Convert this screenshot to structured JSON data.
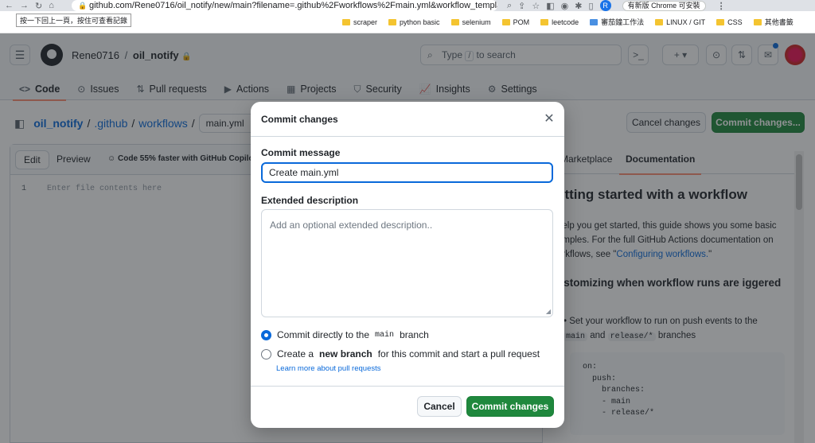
{
  "browser": {
    "url": "github.com/Rene0716/oil_notify/new/main?filename=.github%2Fworkflows%2Fmain.yml&workflow_template=blank",
    "tooltip": "按一下回上一頁，按住可查看記錄",
    "profile_letter": "R",
    "update_label": "有新版 Chrome 可安裝",
    "bookmarks": [
      "scraper",
      "python basic",
      "selenium",
      "POM",
      "leetcode",
      "審茄鐘工作法",
      "LINUX / GIT",
      "CSS"
    ],
    "other_bookmarks": "其他書籤"
  },
  "header": {
    "owner": "Rene0716",
    "separator": "/",
    "repo": "oil_notify",
    "search_placeholder_before": "Type",
    "search_key": "/",
    "search_placeholder_after": "to search",
    "command_label": ">_",
    "plus_label": "+ ▾"
  },
  "tabs": [
    {
      "label": "Code",
      "icon": "code-icon"
    },
    {
      "label": "Issues",
      "icon": "issue-icon"
    },
    {
      "label": "Pull requests",
      "icon": "pull-request-icon"
    },
    {
      "label": "Actions",
      "icon": "play-icon"
    },
    {
      "label": "Projects",
      "icon": "table-icon"
    },
    {
      "label": "Security",
      "icon": "shield-icon"
    },
    {
      "label": "Insights",
      "icon": "graph-icon"
    },
    {
      "label": "Settings",
      "icon": "gear-icon"
    }
  ],
  "editor": {
    "breadcrumb": [
      "oil_notify",
      ".github",
      "workflows"
    ],
    "filename": "main.yml",
    "cancel_label": "Cancel changes",
    "commit_label": "Commit changes...",
    "tab_edit": "Edit",
    "tab_preview": "Preview",
    "copilot_hint": "Code 55% faster with GitHub Copilot",
    "line_number": "1",
    "placeholder": "Enter file contents here"
  },
  "docs": {
    "tab_marketplace": "Marketplace",
    "tab_documentation": "Documentation",
    "title": "etting started with a workflow",
    "para_before": "help you get started, this guide shows you some basic amples. For the full GitHub Actions documentation on orkflows, see \"",
    "para_link": "Configuring workflows.",
    "para_after": "\"",
    "h2": "ustomizing when workflow runs are iggered",
    "bullet_before": "Set your workflow to run on push events to the",
    "bullet_code1": "main",
    "bullet_and": "and",
    "bullet_code2": "release/*",
    "bullet_after": "branches",
    "code": "on:\n  push:\n    branches:\n    - main\n    - release/*"
  },
  "dialog": {
    "title": "Commit changes",
    "message_label": "Commit message",
    "message_value": "Create main.yml",
    "description_label": "Extended description",
    "description_placeholder": "Add an optional extended description..",
    "option1_before": "Commit directly to the",
    "option1_branch": "main",
    "option1_after": "branch",
    "option2_before": "Create a",
    "option2_bold": "new branch",
    "option2_after": "for this commit and start a pull request",
    "learn_more": "Learn more about pull requests",
    "cancel": "Cancel",
    "commit": "Commit changes"
  }
}
